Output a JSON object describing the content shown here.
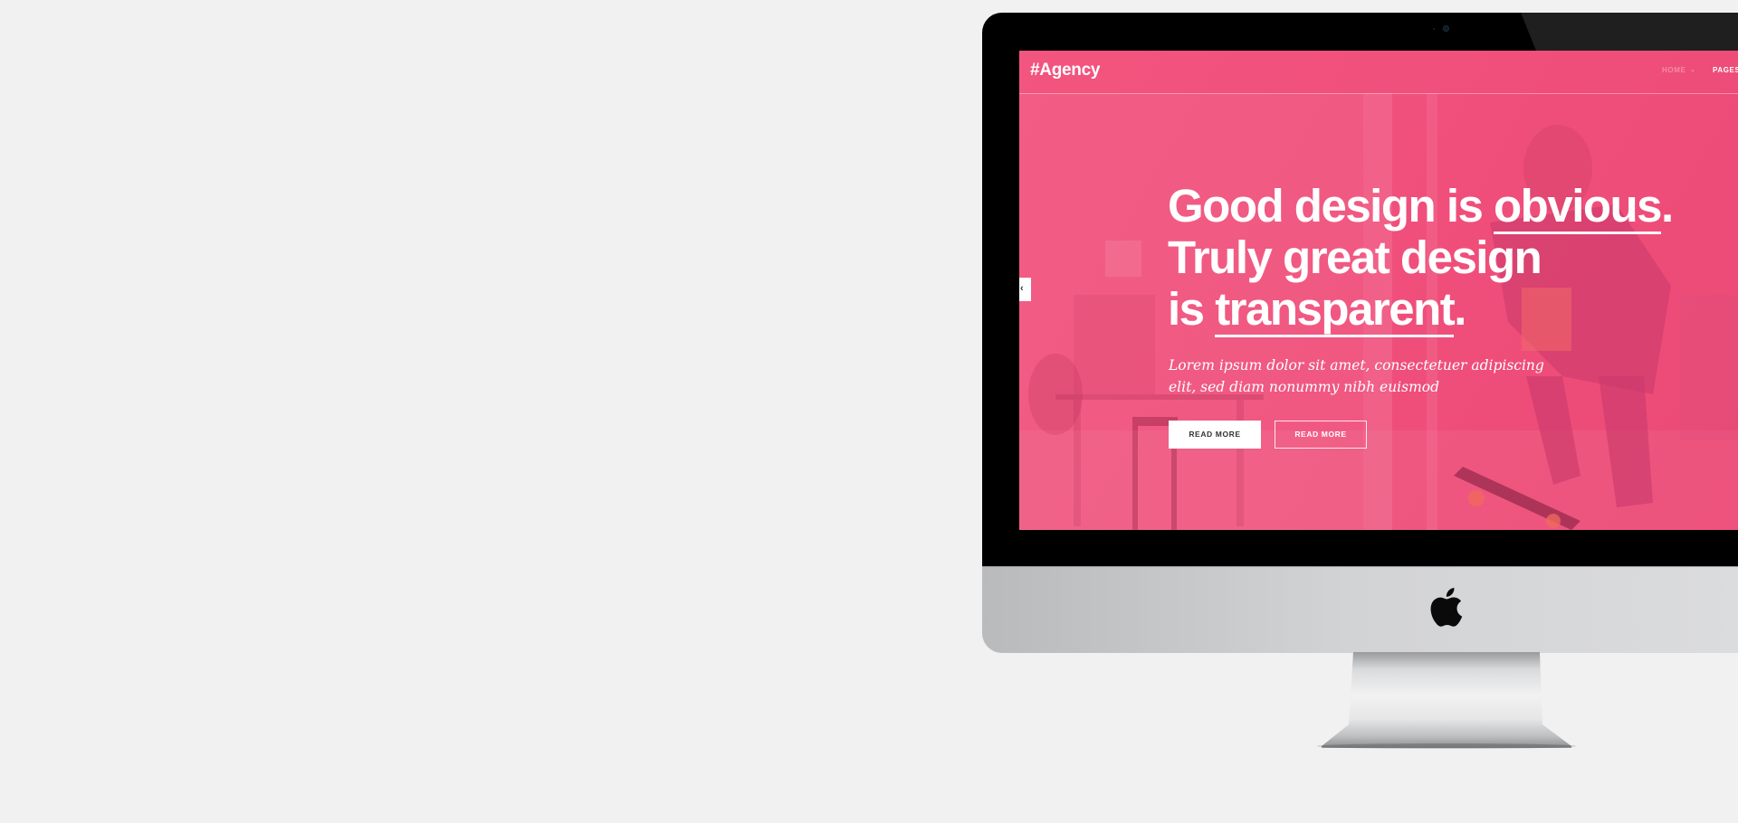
{
  "site": {
    "brand": "#Agency",
    "nav": {
      "home": "HOME",
      "home_caret": "⌄",
      "pages": "PAGES"
    },
    "slider_prev_icon": "‹",
    "hero": {
      "line1_a": "Good design is ",
      "line1_b": "obvious",
      "line1_c": ".",
      "line2": "Truly great design",
      "line3_a": "is ",
      "line3_b": "transparent",
      "line3_c": ".",
      "lead_line1": "Lorem ipsum dolor sit amet, consectetuer adipiscing",
      "lead_line2": "elit, sed diam nonummy nibh euismod",
      "btn_primary": "READ MORE",
      "btn_secondary": "READ MORE"
    }
  },
  "colors": {
    "page_background": "#f1f1f1",
    "accent_pink": "#f0507b",
    "bezel": "#000000",
    "chin": "#d2d3d5"
  },
  "icons": {
    "device_logo": "apple-icon",
    "slider_prev": "chevron-left-icon",
    "camera": "camera-icon"
  }
}
